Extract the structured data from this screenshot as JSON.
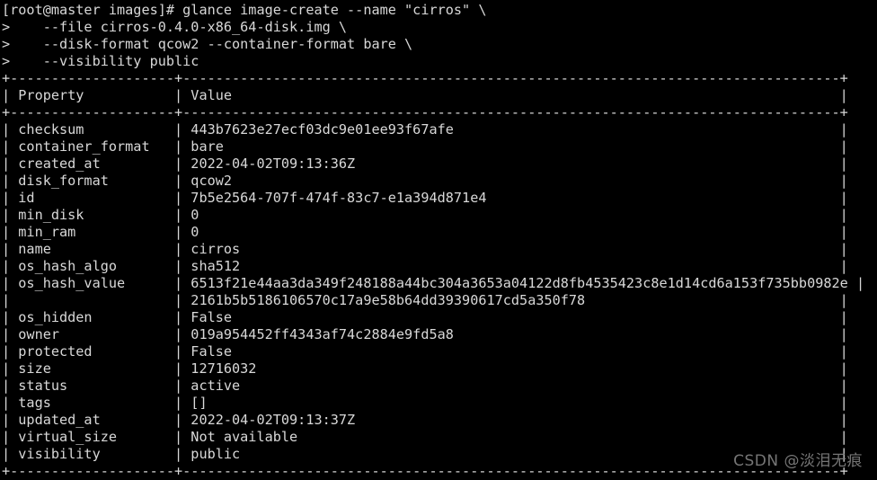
{
  "terminal": {
    "prompt": "[root@master images]#",
    "command_lines": [
      "[root@master images]# glance image-create --name \"cirros\" \\",
      ">    --file cirros-0.4.0-x86_64-disk.img \\",
      ">    --disk-format qcow2 --container-format bare \\",
      ">    --visibility public"
    ],
    "table": {
      "separator": "+----------------------+----------------------------------------------------------------------------------+",
      "header": {
        "property": "Property",
        "value": "Value"
      },
      "column_widths": {
        "property": 18,
        "value": 78
      },
      "rows": [
        {
          "property": "checksum",
          "value": "443b7623e27ecf03dc9e01ee93f67afe"
        },
        {
          "property": "container_format",
          "value": "bare"
        },
        {
          "property": "created_at",
          "value": "2022-04-02T09:13:36Z"
        },
        {
          "property": "disk_format",
          "value": "qcow2"
        },
        {
          "property": "id",
          "value": "7b5e2564-707f-474f-83c7-e1a394d871e4"
        },
        {
          "property": "min_disk",
          "value": "0"
        },
        {
          "property": "min_ram",
          "value": "0"
        },
        {
          "property": "name",
          "value": "cirros"
        },
        {
          "property": "os_hash_algo",
          "value": "sha512"
        },
        {
          "property": "os_hash_value",
          "value": "6513f21e44aa3da349f248188a44bc304a3653a04122d8fb4535423c8e1d14cd6a153f735bb0982e"
        },
        {
          "property": "",
          "value": "2161b5b5186106570c17a9e58b64dd39390617cd5a350f78"
        },
        {
          "property": "os_hidden",
          "value": "False"
        },
        {
          "property": "owner",
          "value": "019a954452ff4343af74c2884e9fd5a8"
        },
        {
          "property": "protected",
          "value": "False"
        },
        {
          "property": "size",
          "value": "12716032"
        },
        {
          "property": "status",
          "value": "active"
        },
        {
          "property": "tags",
          "value": "[]"
        },
        {
          "property": "updated_at",
          "value": "2022-04-02T09:13:37Z"
        },
        {
          "property": "virtual_size",
          "value": "Not available"
        },
        {
          "property": "visibility",
          "value": "public"
        }
      ]
    },
    "watermark": "CSDN @淡泪无痕",
    "colors": {
      "background": "#000000",
      "foreground": "#d8d8d8",
      "watermark": "#7c7c7c"
    }
  }
}
